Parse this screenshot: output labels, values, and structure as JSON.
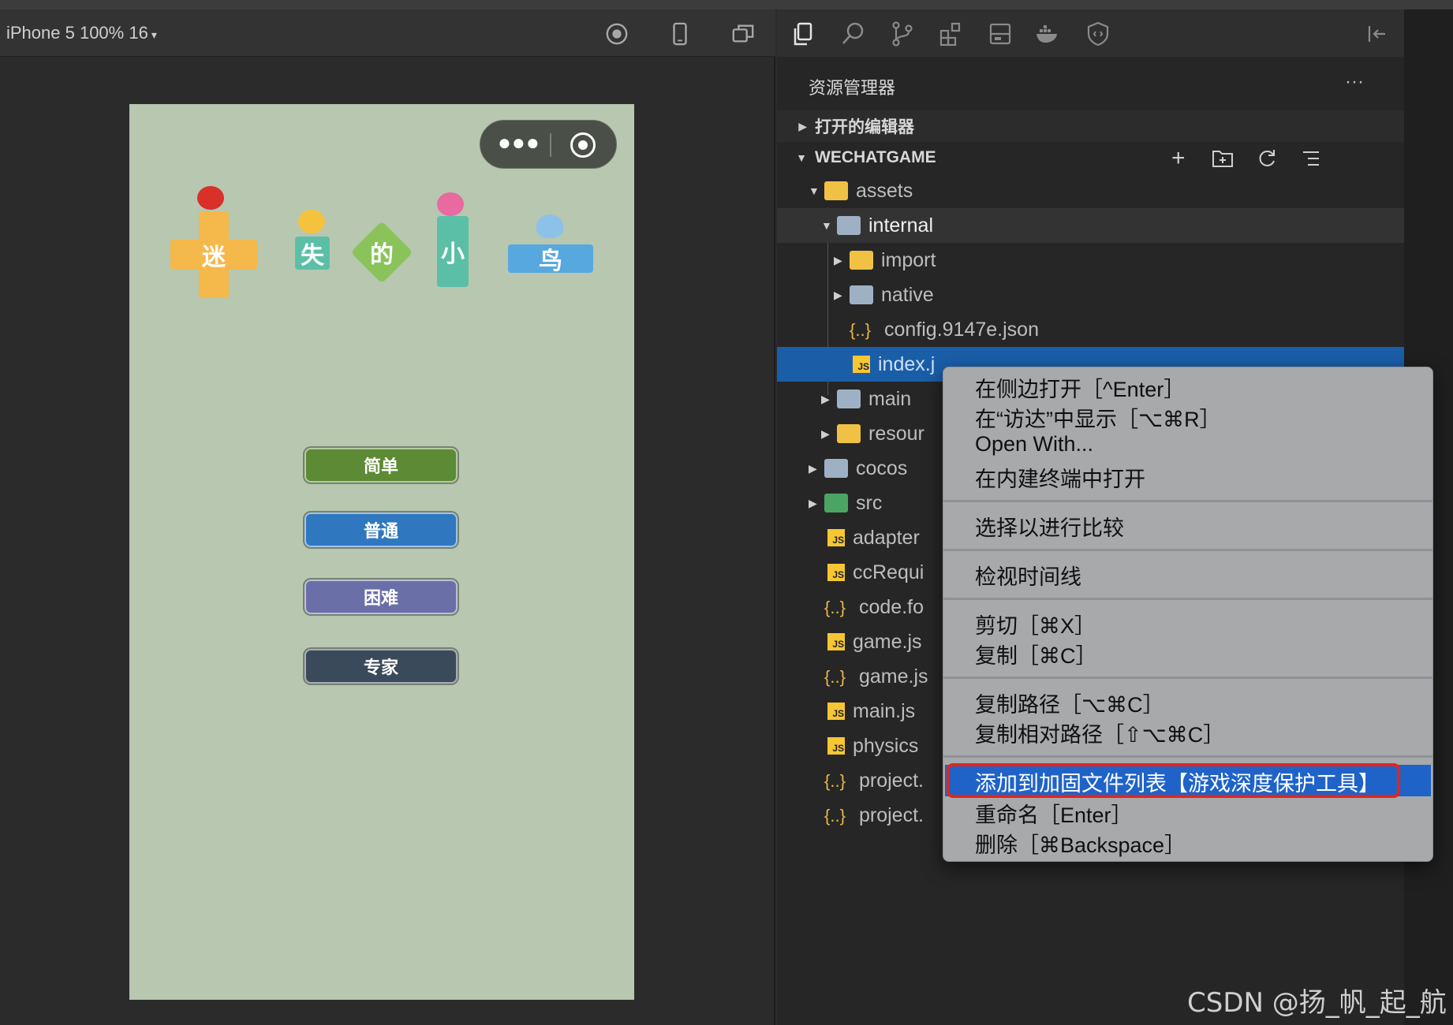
{
  "simulator": {
    "device_label": "iPhone 5 100% 16",
    "game": {
      "title_chars": [
        "迷",
        "失",
        "的",
        "小",
        "鸟"
      ],
      "buttons": [
        "简单",
        "普通",
        "困难",
        "专家"
      ]
    },
    "colors": {
      "background": "#b7c7b0",
      "tile_orange": "#f5b84a",
      "tile_teal": "#5bbfa7",
      "tile_green": "#8ac35a",
      "tile_blue": "#58a8e0",
      "btn_simple": "#5c8a35",
      "btn_normal": "#2f78c0",
      "btn_hard": "#6a6fa8",
      "btn_expert": "#3b4a5a"
    }
  },
  "explorer": {
    "header": "资源管理器",
    "more": "···",
    "open_editors": "打开的编辑器",
    "project": "WECHATGAME",
    "tree": [
      {
        "label": "assets",
        "icon": "folder-yellow-icon"
      },
      {
        "label": "internal",
        "icon": "folder-open-icon"
      },
      {
        "label": "import",
        "icon": "folder-plus-icon"
      },
      {
        "label": "native",
        "icon": "folder-icon"
      },
      {
        "label": "config.9147e.json",
        "icon": "json-icon"
      },
      {
        "label": "index.j",
        "icon": "js-icon"
      },
      {
        "label": "main",
        "icon": "folder-icon"
      },
      {
        "label": "resour",
        "icon": "folder-yellow-icon"
      },
      {
        "label": "cocos",
        "icon": "folder-icon"
      },
      {
        "label": "src",
        "icon": "folder-code-icon"
      },
      {
        "label": "adapter",
        "icon": "js-icon"
      },
      {
        "label": "ccRequi",
        "icon": "js-icon"
      },
      {
        "label": "code.fo",
        "icon": "json-icon"
      },
      {
        "label": "game.js",
        "icon": "js-icon"
      },
      {
        "label": "game.js",
        "icon": "json-icon"
      },
      {
        "label": "main.js",
        "icon": "js-icon"
      },
      {
        "label": "physics",
        "icon": "js-icon"
      },
      {
        "label": "project.",
        "icon": "json-icon"
      },
      {
        "label": "project.",
        "icon": "json-icon"
      }
    ]
  },
  "context_menu": {
    "items": [
      "在侧边打开［^Enter］",
      "在“访达”中显示［⌥⌘R］",
      "Open With...",
      "在内建终端中打开",
      "选择以进行比较",
      "检视时间线",
      "剪切［⌘X］",
      "复制［⌘C］",
      "复制路径［⌥⌘C］",
      "复制相对路径［⇧⌥⌘C］",
      "添加到加固文件列表【游戏深度保护工具】",
      "重命名［Enter］",
      "删除［⌘Backspace］"
    ],
    "highlighted_index": 10
  },
  "watermark": "CSDN @扬_帆_起_航"
}
